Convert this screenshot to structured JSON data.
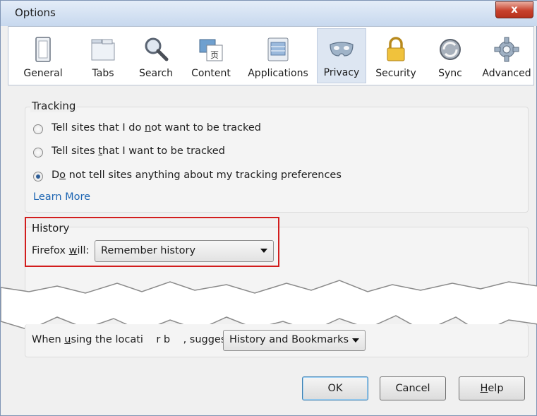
{
  "window": {
    "title": "Options",
    "close_label": "x"
  },
  "tabs": [
    {
      "label": "General",
      "icon": "general-icon"
    },
    {
      "label": "Tabs",
      "icon": "tabs-icon"
    },
    {
      "label": "Search",
      "icon": "search-icon"
    },
    {
      "label": "Content",
      "icon": "content-icon"
    },
    {
      "label": "Applications",
      "icon": "applications-icon"
    },
    {
      "label": "Privacy",
      "icon": "privacy-mask-icon",
      "active": true
    },
    {
      "label": "Security",
      "icon": "padlock-icon"
    },
    {
      "label": "Sync",
      "icon": "sync-icon"
    },
    {
      "label": "Advanced",
      "icon": "gear-icon"
    }
  ],
  "tracking": {
    "title": "Tracking",
    "options": [
      {
        "pre": "Tell sites that I do ",
        "u": "n",
        "post": "ot want to be tracked",
        "checked": false
      },
      {
        "pre": "Tell sites ",
        "u": "t",
        "post": "hat I want to be tracked",
        "checked": false
      },
      {
        "pre": "D",
        "u": "o",
        "post": " not tell sites anything about my tracking preferences",
        "checked": true
      }
    ],
    "learn_more": "Learn More"
  },
  "history": {
    "title": "History",
    "label_pre": "Firefox ",
    "label_u": "w",
    "label_post": "ill:",
    "selected": "Remember history"
  },
  "location_bar": {
    "label_pre": "When ",
    "label_u": "u",
    "label_post": "sing the locati    r b    , suggest:",
    "selected": "History and Bookmarks"
  },
  "buttons": {
    "ok": "OK",
    "cancel": "Cancel",
    "help_u": "H",
    "help_post": "elp"
  },
  "colors": {
    "highlight": "#d21d1d",
    "link": "#1e66b3",
    "active_tab": "#dde6f2"
  }
}
